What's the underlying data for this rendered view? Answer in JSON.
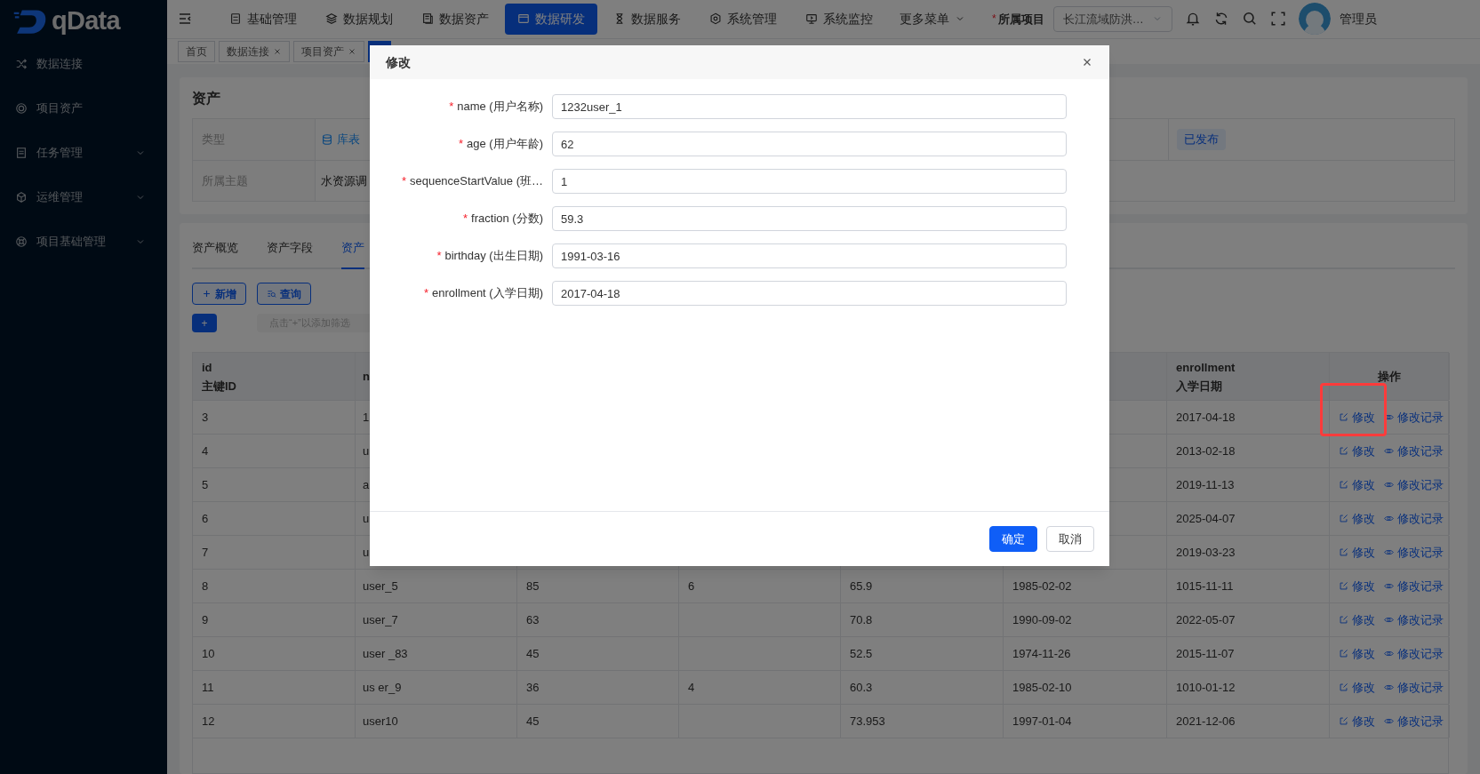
{
  "sidebar": {
    "logo": "qData",
    "items": [
      {
        "label": "数据连接",
        "expandable": false
      },
      {
        "label": "项目资产",
        "expandable": false
      },
      {
        "label": "任务管理",
        "expandable": true
      },
      {
        "label": "运维管理",
        "expandable": true
      },
      {
        "label": "项目基础管理",
        "expandable": true
      }
    ]
  },
  "topbar": {
    "menu": [
      {
        "label": "基础管理",
        "selected": false
      },
      {
        "label": "数据规划",
        "selected": false
      },
      {
        "label": "数据资产",
        "selected": false
      },
      {
        "label": "数据研发",
        "selected": true
      },
      {
        "label": "数据服务",
        "selected": false
      },
      {
        "label": "系统管理",
        "selected": false
      },
      {
        "label": "系统监控",
        "selected": false
      }
    ],
    "more": "更多菜单",
    "project_mark": "*",
    "project_label": "所属项目",
    "project_value": "长江流域防洪…",
    "user": "管理员"
  },
  "tabs": [
    {
      "label": "首页",
      "closable": false,
      "selected": false
    },
    {
      "label": "数据连接",
      "closable": true,
      "selected": false
    },
    {
      "label": "项目资产",
      "closable": true,
      "selected": false
    },
    {
      "closable": false,
      "selected": true
    }
  ],
  "asset_card": {
    "title": "资产",
    "rows": [
      {
        "label": "类型",
        "value": "库表",
        "status": "已发布"
      },
      {
        "label": "所属主题",
        "value": "水资源调"
      }
    ]
  },
  "detail_tabs": [
    {
      "label": "资产概览",
      "selected": false
    },
    {
      "label": "资产字段",
      "selected": false
    },
    {
      "label": "资产",
      "selected": true
    }
  ],
  "actions": [
    {
      "label": "新增"
    },
    {
      "label": "查询"
    }
  ],
  "filter": {
    "add": "+",
    "placeholder": "点击“+”以添加筛选"
  },
  "table": {
    "columns": [
      {
        "title": "id",
        "subtitle": "主键ID"
      },
      {
        "title": "n"
      },
      {},
      {},
      {},
      {},
      {
        "title": "enrollment",
        "subtitle": "入学日期"
      },
      {
        "title": "操作"
      }
    ],
    "rows": [
      {
        "cells": [
          "3",
          "1",
          null,
          null,
          null,
          null,
          "2017-04-18"
        ],
        "actions": [
          "修改",
          "修改记录"
        ],
        "highlighted": true
      },
      {
        "cells": [
          "4",
          "u",
          null,
          null,
          null,
          null,
          "2013-02-18"
        ],
        "actions": [
          "修改",
          "修改记录"
        ],
        "highlighted": false
      },
      {
        "cells": [
          "5",
          "a",
          null,
          null,
          null,
          null,
          "2019-11-13"
        ],
        "actions": [
          "修改",
          "修改记录"
        ],
        "highlighted": false
      },
      {
        "cells": [
          "6",
          "u",
          null,
          null,
          null,
          null,
          "2025-04-07"
        ],
        "actions": [
          "修改",
          "修改记录"
        ],
        "highlighted": false
      },
      {
        "cells": [
          "7",
          "u",
          null,
          null,
          null,
          null,
          "2019-03-23"
        ],
        "actions": [
          "修改",
          "修改记录"
        ],
        "highlighted": false
      },
      {
        "cells": [
          "8",
          "user_5",
          "85",
          "6",
          "65.9",
          "1985-02-02",
          "1015-11-11"
        ],
        "actions": [
          "修改",
          "修改记录"
        ],
        "highlighted": false
      },
      {
        "cells": [
          "9",
          "user_7",
          "63",
          null,
          "70.8",
          "1990-09-02",
          "2022-05-07"
        ],
        "actions": [
          "修改",
          "修改记录"
        ],
        "highlighted": false
      },
      {
        "cells": [
          "10",
          "user _83",
          "45",
          null,
          "52.5",
          "1974-11-26",
          "2015-11-07"
        ],
        "actions": [
          "修改",
          "修改记录"
        ],
        "highlighted": false
      },
      {
        "cells": [
          "11",
          "us er_9",
          "36",
          "4",
          "60.3",
          "1985-02-10",
          "1010-01-12"
        ],
        "actions": [
          "修改",
          "修改记录"
        ],
        "highlighted": false
      },
      {
        "cells": [
          "12",
          "user10",
          "45",
          null,
          "73.953",
          "1997-01-04",
          "2021-12-06"
        ],
        "actions": [
          "修改",
          "修改记录"
        ],
        "highlighted": false
      }
    ]
  },
  "dialog": {
    "title": "修改",
    "fields": [
      {
        "mark": "*",
        "label": "name (用户名称)",
        "value": "1232user_1"
      },
      {
        "mark": "*",
        "label": "age (用户年龄)",
        "value": "62"
      },
      {
        "mark": "*",
        "label": "sequenceStartValue (班…",
        "value": "1"
      },
      {
        "mark": "*",
        "label": "fraction (分数)",
        "value": "59.3"
      },
      {
        "mark": "*",
        "label": "birthday (出生日期)",
        "value": "1991-03-16"
      },
      {
        "mark": "*",
        "label": "enrollment (入学日期)",
        "value": "2017-04-18"
      }
    ],
    "buttons": [
      {
        "label": "确定",
        "kind": "primary"
      },
      {
        "label": "取消",
        "kind": "default"
      }
    ]
  }
}
